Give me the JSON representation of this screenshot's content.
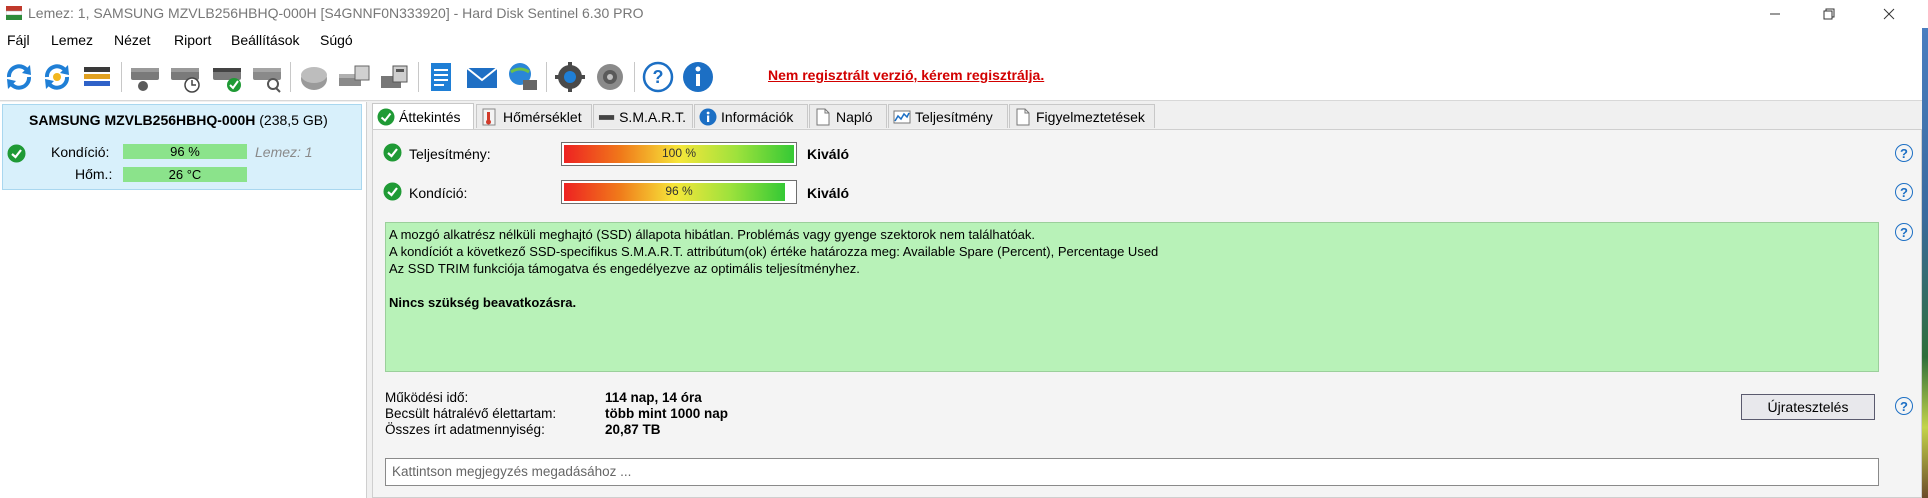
{
  "window": {
    "title": "Lemez: 1, SAMSUNG MZVLB256HBHQ-000H [S4GNNF0N333920]  -  Hard Disk Sentinel 6.30 PRO"
  },
  "menu": [
    "Fájl",
    "Lemez",
    "Nézet",
    "Riport",
    "Beállítások",
    "Súgó"
  ],
  "toolbar": {
    "icons": [
      "refresh-icon",
      "refresh-all-icon",
      "disk-list-icon",
      "disk-info-icon",
      "disk-schedule-icon",
      "disk-ok-icon",
      "disk-search-icon",
      "disk-surface-icon",
      "disk-tools-icon",
      "disk-backup-icon",
      "report-icon",
      "mail-icon",
      "network-icon",
      "settings-icon",
      "sound-icon",
      "help-icon",
      "about-icon"
    ],
    "registration_notice": "Nem regisztrált verzió, kérem regisztrálja."
  },
  "disk": {
    "name": "SAMSUNG MZVLB256HBHQ-000H",
    "size": "(238,5 GB)",
    "condition_label": "Kondíció:",
    "condition_value": "96 %",
    "condition_pct": 96,
    "disk_index": "Lemez: 1",
    "temp_label": "Hőm.:",
    "temp_value": "26 °C"
  },
  "tabs": [
    {
      "label": "Áttekintés",
      "icon": "check-circle-icon",
      "active": true
    },
    {
      "label": "Hőmérséklet",
      "icon": "thermometer-icon",
      "active": false
    },
    {
      "label": "S.M.A.R.T.",
      "icon": "disk-strip-icon",
      "active": false
    },
    {
      "label": "Információk",
      "icon": "info-icon",
      "active": false
    },
    {
      "label": "Napló",
      "icon": "log-page-icon",
      "active": false
    },
    {
      "label": "Teljesítmény",
      "icon": "performance-chart-icon",
      "active": false
    },
    {
      "label": "Figyelmeztetések",
      "icon": "alerts-page-icon",
      "active": false
    }
  ],
  "overview": {
    "performance_label": "Teljesítmény:",
    "performance_value": "100 %",
    "performance_pct": 100,
    "performance_rating": "Kiváló",
    "health_label": "Kondíció:",
    "health_value": "96 %",
    "health_pct": 96,
    "health_rating": "Kiváló",
    "description_lines": [
      "A mozgó alkatrész nélküli meghajtó (SSD) állapota hibátlan. Problémás vagy gyenge szektorok nem találhatóak.",
      "A kondíciót a következő SSD-specifikus S.M.A.R.T. attribútum(ok) értéke határozza meg:  Available Spare (Percent), Percentage Used",
      "Az SSD TRIM funkciója támogatva és engedélyezve az optimális teljesítményhez."
    ],
    "action_text": "Nincs szükség beavatkozásra.",
    "uptime_label": "Működési idő:",
    "uptime_value": "114 nap, 14 óra",
    "lifetime_label": "Becsült hátralévő élettartam:",
    "lifetime_value": "több mint 1000 nap",
    "written_label": "Összes írt adatmennyiség:",
    "written_value": "20,87 TB",
    "retest_label": "Újratesztelés",
    "note_placeholder": "Kattintson megjegyzés megadásához ..."
  },
  "colors": {
    "accent_blue": "#1c6fc4",
    "ok_green": "#1f9a35",
    "status_box_green": "#b8f2b8",
    "notice_red": "#d20000"
  }
}
